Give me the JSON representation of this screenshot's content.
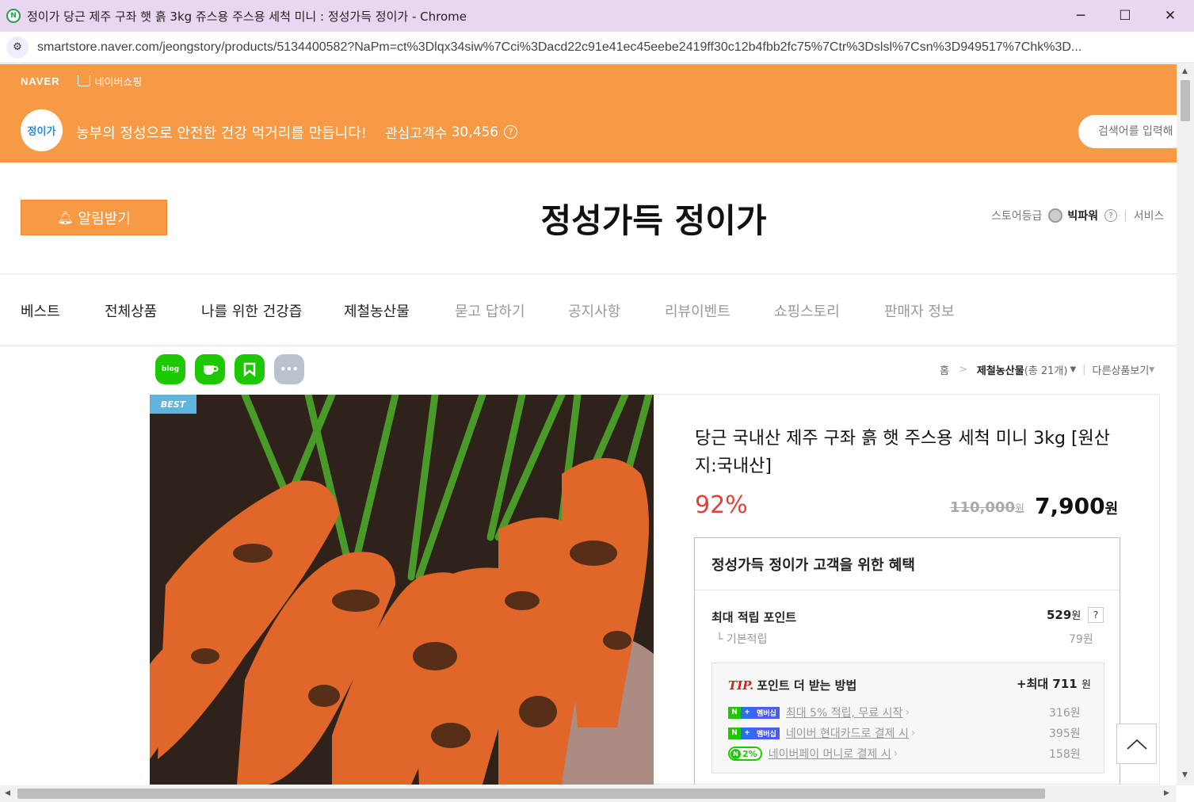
{
  "window": {
    "title": "정이가 당근 제주 구좌 햇 흙 3kg 쥬스용 주스용 세척 미니 : 정성가득 정이가 - Chrome",
    "favicon": "naver-smartstore-icon",
    "minimize": "─",
    "maximize": "☐",
    "close": "✕"
  },
  "address": {
    "url": "smartstore.naver.com/jeongstory/products/5134400582?NaPm=ct%3Dlqx34siw%7Cci%3Dacd22c91e41ec45eebe2419ff30c12b4fbb2fc75%7Ctr%3Dslsl%7Csn%3D949517%7Chk%3D..."
  },
  "topbar": {
    "naver": "NAVER",
    "shopping": "네이버쇼핑"
  },
  "store": {
    "logo_text": "정이가",
    "slogan": "농부의 정성으로 안전한 건강 먹거리를 만듭니다!",
    "interest_label": "관심고객수",
    "interest_count": "30,456",
    "search_placeholder": "검색어를 입력해",
    "alarm_label": "알림받기",
    "name": "정성가득 정이가",
    "grade_label": "스토어등급",
    "grade_value": "빅파워",
    "service_label": "서비스"
  },
  "nav": {
    "items": [
      "베스트",
      "전체상품",
      "나를 위한 건강즙",
      "제철농산물",
      "묻고 답하기",
      "공지사항",
      "리뷰이벤트",
      "쇼핑스토리",
      "판매자 정보"
    ]
  },
  "share": {
    "blog": "blog",
    "cafe": "cafe",
    "band": "band",
    "more": "•••"
  },
  "breadcrumb": {
    "home": "홈",
    "category": "제철농산물",
    "count": "(총 21개)",
    "other": "다른상품보기"
  },
  "product": {
    "badge": "BEST",
    "title": "당근 국내산 제주 구좌 흙 햇 주스용 세척 미니 3kg [원산지:국내산]",
    "discount": "92%",
    "original_price": "110,000",
    "sale_price": "7,900",
    "won": "원"
  },
  "benefit": {
    "title": "정성가득 정이가 고객을 위한 혜택",
    "max_point_label": "최대 적립 포인트",
    "max_point_value": "529",
    "base_label": "기본적립",
    "base_value": "79원",
    "tip_word": "TIP.",
    "tip_title": "포인트 더 받는 방법",
    "tip_max": "+최대 711",
    "rows": [
      {
        "label": "최대 5% 적립, 무료 시작",
        "value": "316원",
        "badge": "멤버십"
      },
      {
        "label": "네이버 현대카드로 결제 시",
        "value": "395원",
        "badge": "멤버십"
      },
      {
        "label": "네이버페이 머니로 결제 시",
        "value": "158원",
        "badge": "2%"
      }
    ]
  },
  "colors": {
    "brand_orange": "#f79a46",
    "discount_red": "#e0413b",
    "naver_green": "#1ec800"
  }
}
